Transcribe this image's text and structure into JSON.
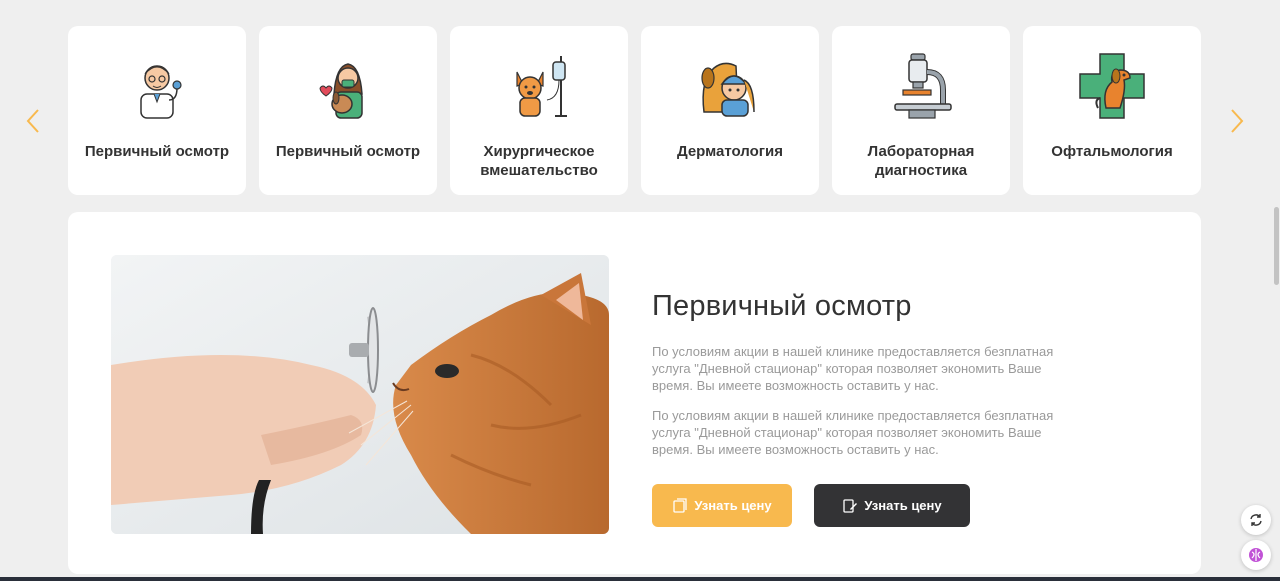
{
  "carousel": {
    "prev_icon": "chevron-left-icon",
    "next_icon": "chevron-right-icon",
    "arrow_color": "#f8b94e",
    "cards": [
      {
        "label": "Первичный осмотр",
        "icon": "doctor-icon"
      },
      {
        "label": "Первичный осмотр",
        "icon": "vet-with-dog-icon"
      },
      {
        "label": "Хирургическое вмешательство",
        "icon": "dog-iv-drip-icon"
      },
      {
        "label": "Дерматология",
        "icon": "dog-with-child-icon"
      },
      {
        "label": "Лабораторная диагностика",
        "icon": "microscope-icon"
      },
      {
        "label": "Офтальмология",
        "icon": "dog-medical-cross-icon"
      }
    ]
  },
  "detail": {
    "title": "Первичный осмотр",
    "paragraphs": [
      "По условиям акции в нашей клинике предоставляется безплатная услуга \"Дневной стационар\" которая позволяет экономить Ваше время. Вы имеете возможность оставить у нас.",
      "По условиям акции в нашей клинике предоставляется безплатная услуга \"Дневной стационар\" которая позволяет экономить Ваше время. Вы имеете возможность оставить у нас."
    ],
    "image": "cat-with-stethoscope-photo",
    "buttons": {
      "primary_label": "Узнать цену",
      "primary_icon": "price-tag-icon",
      "secondary_label": "Узнать цену",
      "secondary_icon": "edit-document-icon"
    }
  },
  "floating": {
    "top_icon": "refresh-icon",
    "bottom_icon": "assistant-brain-icon"
  },
  "colors": {
    "accent": "#f8b94e",
    "dark_button": "#333335",
    "background": "#efefef"
  }
}
